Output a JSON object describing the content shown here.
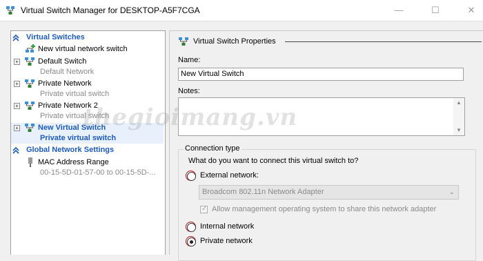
{
  "window": {
    "title": "Virtual Switch Manager for DESKTOP-A5F7CGA",
    "minimize_glyph": "—",
    "maximize_glyph": "☐",
    "close_glyph": "✕"
  },
  "sidebar": {
    "virtual_switches_header": "Virtual Switches",
    "new_switch_label": "New virtual network switch",
    "switches": [
      {
        "label": "Default Switch",
        "sub": "Default Network"
      },
      {
        "label": "Private Network",
        "sub": "Private virtual switch"
      },
      {
        "label": "Private Network 2",
        "sub": "Private virtual switch"
      },
      {
        "label": "New Virtual Switch",
        "sub": "Private virtual switch",
        "selected": true
      }
    ],
    "global_header": "Global Network Settings",
    "mac": {
      "label": "MAC Address Range",
      "sub": "00-15-5D-01-57-00 to 00-15-5D-..."
    }
  },
  "properties": {
    "title": "Virtual Switch Properties",
    "name_label": "Name:",
    "name_value": "New Virtual Switch",
    "notes_label": "Notes:",
    "notes_value": "",
    "connection_group": "Connection type",
    "question": "What do you want to connect this virtual switch to?",
    "external_label": "External network:",
    "adapter": "Broadcom 802.11n Network Adapter",
    "allow_mgmt_label": "Allow management operating system to share this network adapter",
    "internal_label": "Internal network",
    "private_label": "Private network",
    "selected_type": "Private network"
  },
  "watermark": "thegioimang.vn",
  "colors": {
    "accent": "#1d5bb8",
    "highlight_ring": "#b3161d"
  },
  "icons": {
    "network": "network-switch-icon",
    "add": "add-network-icon",
    "collapse": "collapse-chevron-icon",
    "mac": "mac-plug-icon"
  }
}
